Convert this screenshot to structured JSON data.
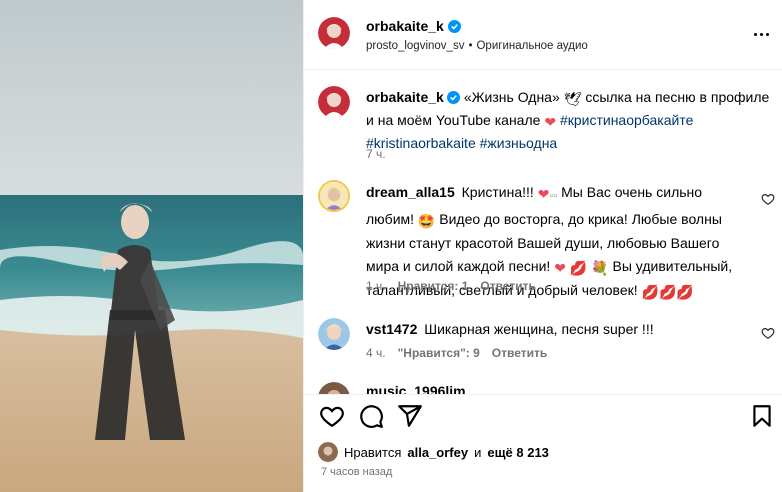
{
  "post": {
    "author": "orbakaite_k",
    "audio_author": "prosto_logvinov_sv",
    "audio_label": "Оригинальное аудио",
    "dot": "•"
  },
  "caption": {
    "author": "orbakaite_k",
    "text_1": "«Жизнь Одна»",
    "text_2": "ссылка на песню в профиле и на моём YouTube канале",
    "hashtag_1": "#кристинаорбакайте",
    "hashtag_2": "#kristinaorbakaite",
    "hashtag_3": "#жизньодна",
    "time": "7 ч."
  },
  "comments": [
    {
      "author": "dream_alla15",
      "text_1": "Кристина!!!",
      "text_2": "Мы Вас очень сильно любим!",
      "text_3": "Видео до восторга, до крика! Любые волны жизни станут красотой Вашей души, любовью Вашего мира и силой каждой песни!",
      "text_4": "Вы удивительный, талантливый, светлый и добрый человек!",
      "time": "1 ч.",
      "likes": "Нравится: 1",
      "reply": "Ответить"
    },
    {
      "author": "vst1472",
      "text": "Шикарная женщина, песня super !!!",
      "time": "4 ч.",
      "likes": "\"Нравится\": 9",
      "reply": "Ответить"
    },
    {
      "author": "music_1996lim",
      "text": "..."
    }
  ],
  "footer": {
    "likes_prefix": "Нравится",
    "liked_by": "alla_orfey",
    "likes_middle": "и",
    "likes_count": "ещё 8 213",
    "post_time": "7 часов назад"
  },
  "colors": {
    "verified": "#0095f6",
    "hashtag": "#00376b",
    "secondary_text": "#737373",
    "heart_red": "#ed4956"
  },
  "icons": [
    "verified-icon",
    "more-icon",
    "heart-icon",
    "comment-icon",
    "share-icon",
    "bookmark-icon"
  ]
}
